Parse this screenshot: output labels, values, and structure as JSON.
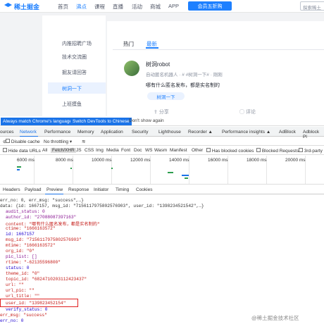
{
  "nav": {
    "logo_text": "稀土掘金",
    "items": [
      {
        "label": "首页",
        "active": false
      },
      {
        "label": "沸点",
        "active": true
      },
      {
        "label": "课程",
        "active": false
      },
      {
        "label": "直播",
        "active": false
      },
      {
        "label": "活动",
        "active": false
      },
      {
        "label": "商城",
        "active": false
      },
      {
        "label": "APP",
        "active": false
      },
      {
        "label": "插件",
        "active": false
      }
    ],
    "vip_button": "会员五折购",
    "search_placeholder": "探索稀土"
  },
  "sidebar": {
    "items": [
      {
        "label": "内推招聘广场",
        "active": false
      },
      {
        "label": "技术交流圈",
        "active": false
      },
      {
        "label": "掘友请回答",
        "active": false
      },
      {
        "label": "树洞一下",
        "active": true
      },
      {
        "label": "上班摸鱼",
        "active": false
      }
    ]
  },
  "feed": {
    "tabs": [
      {
        "label": "热门",
        "active": false
      },
      {
        "label": "最新",
        "active": true
      }
    ],
    "post": {
      "author": "树洞robot",
      "meta": "自动匿名机器人 · # #树洞一下# · 刚刚",
      "body": "哪有什么匿名发布，都是实名制的",
      "topic": "树洞一下",
      "actions": [
        "分享",
        "评论"
      ]
    }
  },
  "devtools": {
    "banner": {
      "btn1": "Always match Chrome's language",
      "btn2": "Switch DevTools to Chinese",
      "link": "Don't show again"
    },
    "tabs": [
      "ources",
      "Network",
      "Performance",
      "Memory",
      "Application",
      "Security",
      "Lighthouse",
      "Recorder ▲",
      "Performance insights ▲",
      "AdBlock",
      "Adblock Pl"
    ],
    "toolbar1": {
      "disable_cache": "Disable cache",
      "throttling": "No throttling"
    },
    "toolbar2": {
      "hide_data_urls": "Hide data URLs",
      "filters": [
        "All",
        "Fetch/XHR",
        "JS",
        "CSS",
        "Img",
        "Media",
        "Font",
        "Doc",
        "WS",
        "Wasm",
        "Manifest",
        "Other"
      ],
      "blocked_cookies": "Has blocked cookies",
      "blocked_requests": "Blocked Requests",
      "third_party": "3rd-party"
    },
    "timeline_ticks": [
      "6000 ms",
      "8000 ms",
      "10000 ms",
      "12000 ms",
      "14000 ms",
      "16000 ms",
      "18000 ms",
      "20000 ms"
    ],
    "detail_tabs": [
      "Headers",
      "Payload",
      "Preview",
      "Response",
      "Initiator",
      "Timing",
      "Cookies"
    ],
    "preview_lines": [
      "err_no: 0, err_msg: \"success\",…}",
      "data: {id: 1667157, msg_id: \"7156117975802576903\", user_id: \"1398234521542\",…}",
      "audit_status: 0",
      "author_id: \"27088087397163\"",
      "content: \"哪有什么匿名发布，都是实名制的\"",
      "ctime: \"1666163572\"",
      "id: 1667157",
      "msg_id: \"7156117975802576903\"",
      "mtime: \"1666163572\"",
      "org_id: \"0\"",
      "pic_list: []",
      "rtime: \"-62135596800\"",
      "status: 0",
      "theme_id: \"0\"",
      "topic_id: \"6824710203112423437\"",
      "url: \"\"",
      "url_pic: \"\"",
      "url_title: \"\"",
      "user_id: \"139823452154\"",
      "verify_status: 0",
      "err_msg: \"success\"",
      "err_no: 0"
    ],
    "watermark": "@稀土掘金技术社区"
  }
}
